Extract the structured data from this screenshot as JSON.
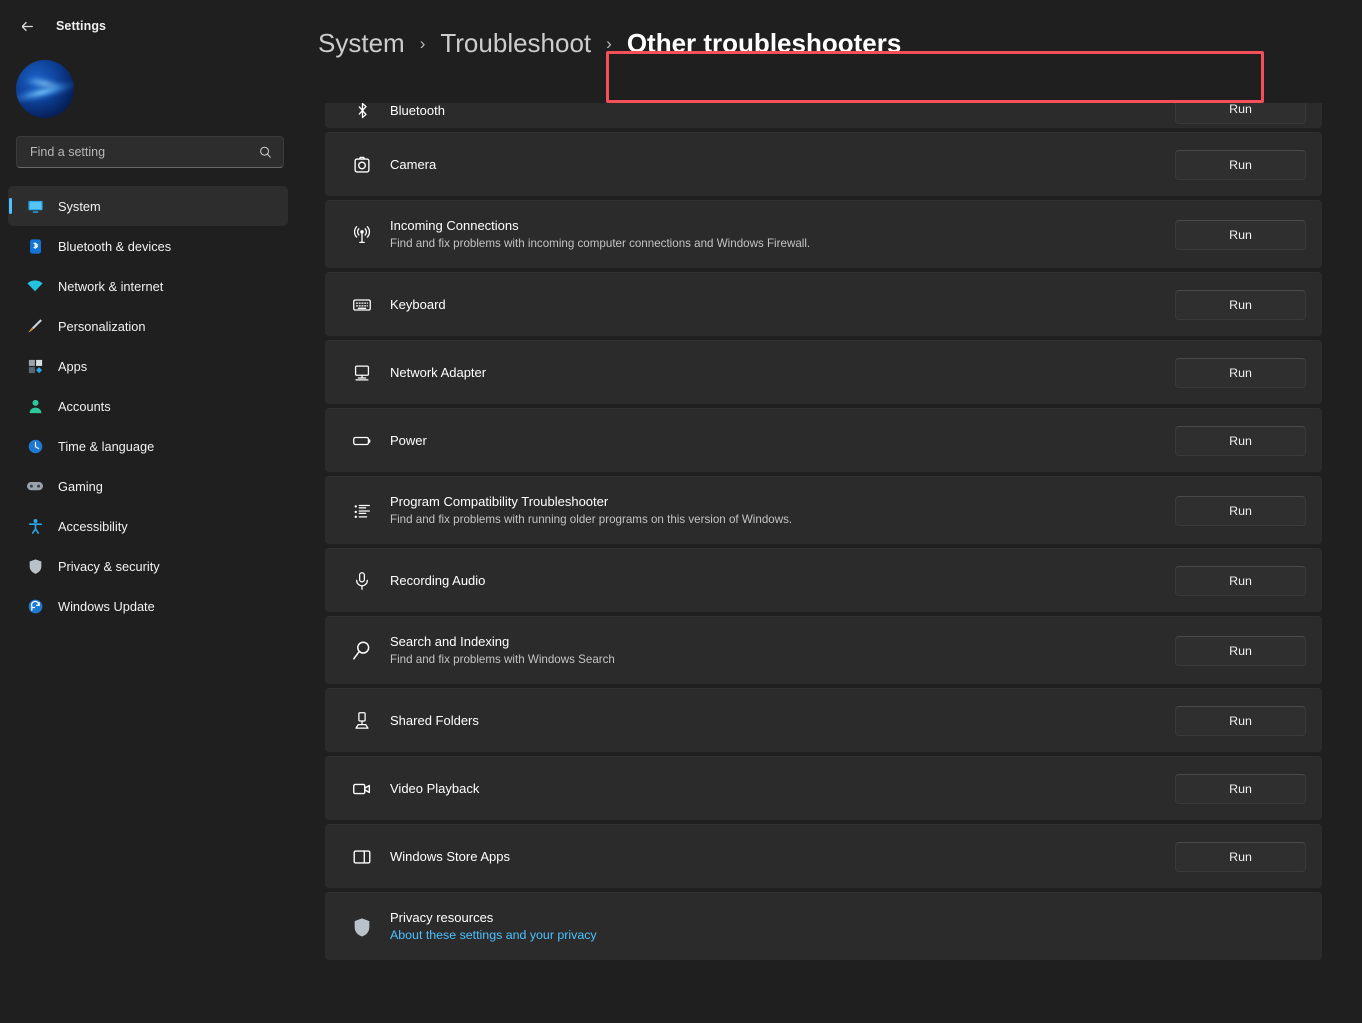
{
  "window": {
    "app_title": "Settings",
    "back_icon": "back-arrow-icon"
  },
  "sidebar": {
    "avatar_name": "user-avatar",
    "search": {
      "placeholder": "Find a setting",
      "value": "",
      "icon": "search-icon"
    },
    "items": [
      {
        "label": "System",
        "icon": "display-monitor-icon",
        "selected": true
      },
      {
        "label": "Bluetooth & devices",
        "icon": "bluetooth-icon",
        "selected": false
      },
      {
        "label": "Network & internet",
        "icon": "wifi-icon",
        "selected": false
      },
      {
        "label": "Personalization",
        "icon": "paintbrush-icon",
        "selected": false
      },
      {
        "label": "Apps",
        "icon": "apps-grid-icon",
        "selected": false
      },
      {
        "label": "Accounts",
        "icon": "person-icon",
        "selected": false
      },
      {
        "label": "Time & language",
        "icon": "clock-icon",
        "selected": false
      },
      {
        "label": "Gaming",
        "icon": "gamepad-icon",
        "selected": false
      },
      {
        "label": "Accessibility",
        "icon": "accessibility-icon",
        "selected": false
      },
      {
        "label": "Privacy & security",
        "icon": "shield-icon",
        "selected": false
      },
      {
        "label": "Windows Update",
        "icon": "update-refresh-icon",
        "selected": false
      }
    ]
  },
  "breadcrumb": {
    "separator": "›",
    "crumbs": [
      {
        "label": "System",
        "current": false
      },
      {
        "label": "Troubleshoot",
        "current": false
      },
      {
        "label": "Other troubleshooters",
        "current": true
      }
    ]
  },
  "highlights": {
    "accent_color": "#f4505a",
    "breadcrumb_highlighted": true,
    "windows_store_apps_run_highlighted": true
  },
  "main": {
    "run_label": "Run",
    "troubleshooters": [
      {
        "title": "Bluetooth",
        "desc": "",
        "icon": "bluetooth-icon",
        "action": "Run",
        "clipped": true
      },
      {
        "title": "Camera",
        "desc": "",
        "icon": "camera-icon",
        "action": "Run"
      },
      {
        "title": "Incoming Connections",
        "desc": "Find and fix problems with incoming computer connections and Windows Firewall.",
        "icon": "broadcast-signal-icon",
        "action": "Run"
      },
      {
        "title": "Keyboard",
        "desc": "",
        "icon": "keyboard-icon",
        "action": "Run"
      },
      {
        "title": "Network Adapter",
        "desc": "",
        "icon": "network-adapter-icon",
        "action": "Run"
      },
      {
        "title": "Power",
        "desc": "",
        "icon": "battery-icon",
        "action": "Run"
      },
      {
        "title": "Program Compatibility Troubleshooter",
        "desc": "Find and fix problems with running older programs on this version of Windows.",
        "icon": "list-checklist-icon",
        "action": "Run"
      },
      {
        "title": "Recording Audio",
        "desc": "",
        "icon": "microphone-icon",
        "action": "Run"
      },
      {
        "title": "Search and Indexing",
        "desc": "Find and fix problems with Windows Search",
        "icon": "magnifier-icon",
        "action": "Run"
      },
      {
        "title": "Shared Folders",
        "desc": "",
        "icon": "shared-folder-icon",
        "action": "Run"
      },
      {
        "title": "Video Playback",
        "desc": "",
        "icon": "video-camera-icon",
        "action": "Run"
      },
      {
        "title": "Windows Store Apps",
        "desc": "",
        "icon": "store-window-icon",
        "action": "Run",
        "highlighted": true
      }
    ],
    "privacy": {
      "title": "Privacy resources",
      "link": "About these settings and your privacy",
      "icon": "shield-icon",
      "link_color": "#4cc2ff"
    }
  },
  "colors": {
    "page_bg": "#1f1f1f",
    "card_bg": "#2b2b2b",
    "accent_blue": "#4cc2ff",
    "highlight_red": "#f4505a"
  }
}
